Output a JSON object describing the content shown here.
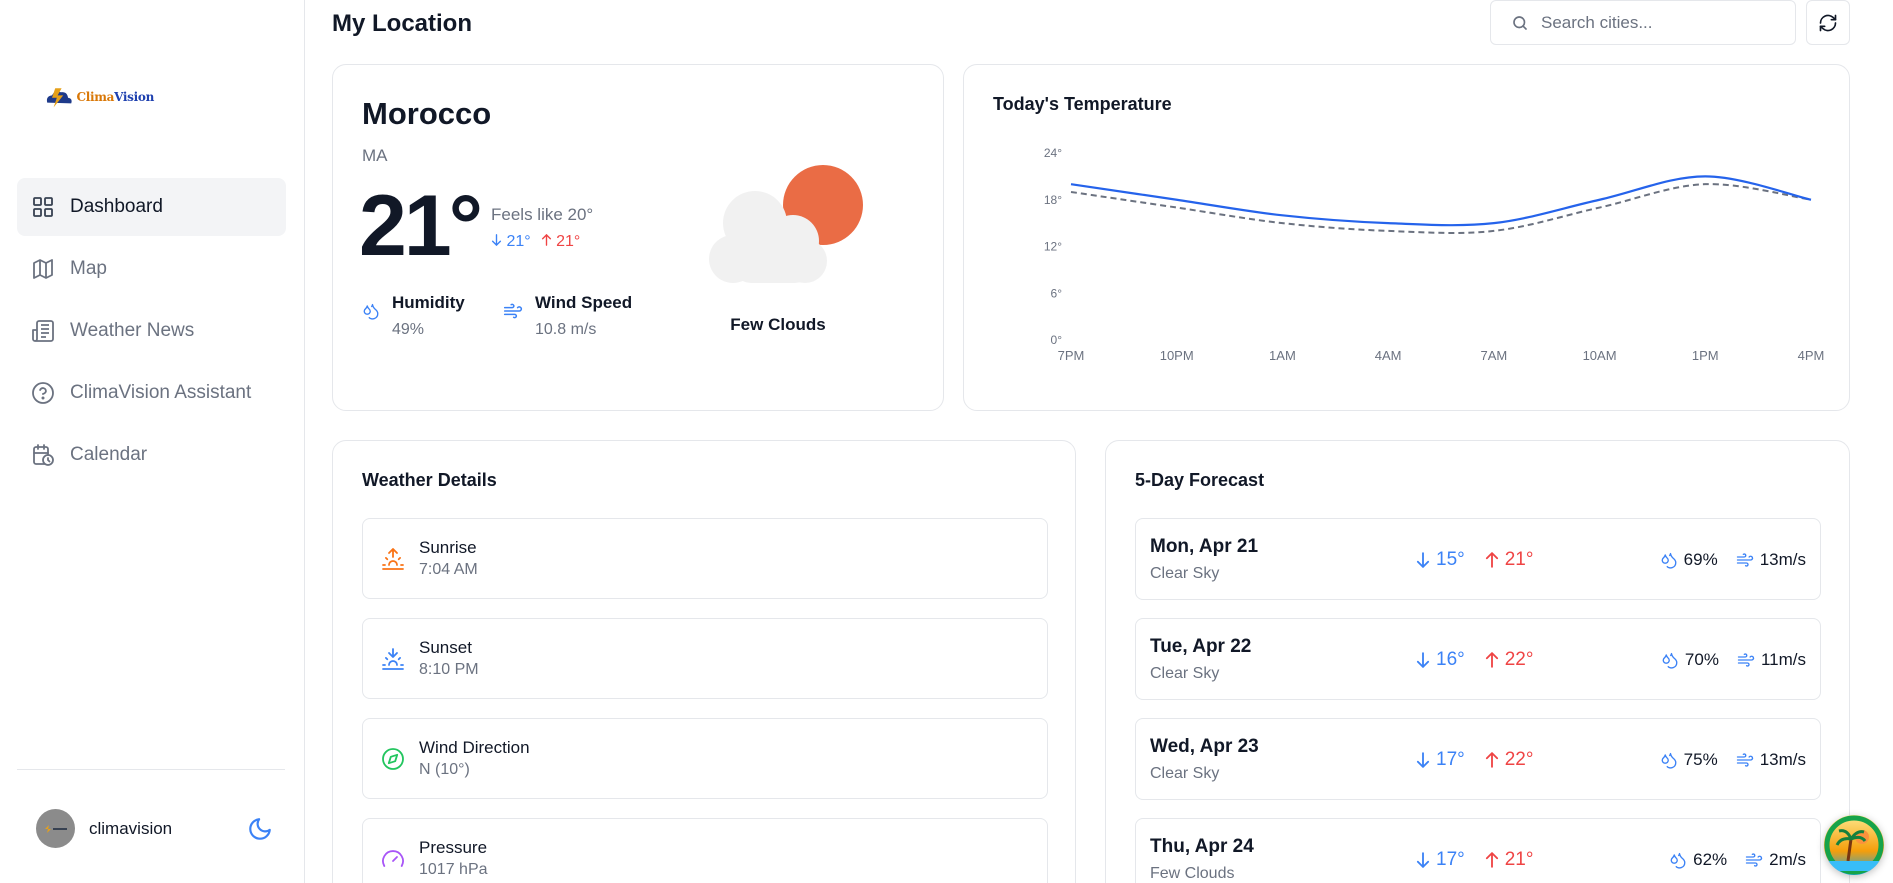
{
  "app": {
    "logo_text_prefix": "Clima",
    "logo_text_suffix": "Vision"
  },
  "sidebar": {
    "items": [
      {
        "label": "Dashboard",
        "icon": "grid-icon",
        "active": true
      },
      {
        "label": "Map",
        "icon": "map-icon",
        "active": false
      },
      {
        "label": "Weather News",
        "icon": "newspaper-icon",
        "active": false
      },
      {
        "label": "ClimaVision Assistant",
        "icon": "help-circle-icon",
        "active": false
      },
      {
        "label": "Calendar",
        "icon": "calendar-icon",
        "active": false
      }
    ],
    "user": {
      "name": "climavision"
    },
    "theme_icon": "moon-icon"
  },
  "header": {
    "title": "My Location",
    "search_placeholder": "Search cities...",
    "refresh_icon": "refresh-icon"
  },
  "current": {
    "country": "Morocco",
    "code": "MA",
    "temp": "21°",
    "feels_like": "Feels like 20°",
    "min": "21°",
    "max": "21°",
    "humidity_label": "Humidity",
    "humidity_value": "49%",
    "wind_label": "Wind Speed",
    "wind_value": "10.8 m/s",
    "condition": "Few Clouds",
    "icon": "few-clouds-icon"
  },
  "chart_data": {
    "type": "line",
    "title": "Today's Temperature",
    "categories": [
      "7PM",
      "10PM",
      "1AM",
      "4AM",
      "7AM",
      "10AM",
      "1PM",
      "4PM"
    ],
    "series": [
      {
        "values": [
          20,
          18,
          16,
          15,
          15,
          18,
          21,
          18
        ],
        "color": "#2563eb",
        "style": "solid"
      },
      {
        "values": [
          19,
          17,
          15,
          14,
          14,
          17,
          20,
          18
        ],
        "color": "#6b7280",
        "style": "dashed"
      }
    ],
    "yticks": [
      "0°",
      "6°",
      "12°",
      "18°",
      "24°"
    ],
    "ylim": [
      0,
      24
    ]
  },
  "details": {
    "title": "Weather Details",
    "rows": [
      {
        "label": "Sunrise",
        "value": "7:04 AM",
        "icon": "sunrise-icon",
        "color": "#f97316"
      },
      {
        "label": "Sunset",
        "value": "8:10 PM",
        "icon": "sunset-icon",
        "color": "#3b82f6"
      },
      {
        "label": "Wind Direction",
        "value": "N (10°)",
        "icon": "compass-icon",
        "color": "#22c55e"
      },
      {
        "label": "Pressure",
        "value": "1017 hPa",
        "icon": "gauge-icon",
        "color": "#a855f7"
      }
    ]
  },
  "forecast": {
    "title": "5-Day Forecast",
    "rows": [
      {
        "day": "Mon, Apr 21",
        "cond": "Clear Sky",
        "min": "15°",
        "max": "21°",
        "humidity": "69%",
        "wind": "13m/s"
      },
      {
        "day": "Tue, Apr 22",
        "cond": "Clear Sky",
        "min": "16°",
        "max": "22°",
        "humidity": "70%",
        "wind": "11m/s"
      },
      {
        "day": "Wed, Apr 23",
        "cond": "Clear Sky",
        "min": "17°",
        "max": "22°",
        "humidity": "75%",
        "wind": "13m/s"
      },
      {
        "day": "Thu, Apr 24",
        "cond": "Few Clouds",
        "min": "17°",
        "max": "21°",
        "humidity": "62%",
        "wind": "2m/s"
      }
    ]
  }
}
